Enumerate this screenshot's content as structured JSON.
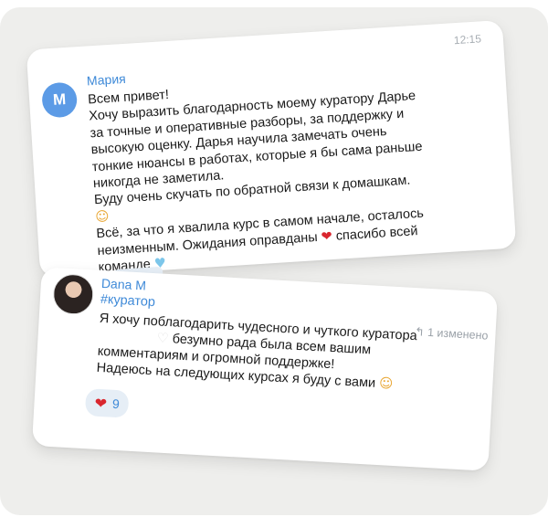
{
  "card1": {
    "time": "12:15",
    "avatar_letter": "М",
    "author": "Мария",
    "lines": [
      "Всем привет!",
      "Хочу выразить благодарность моему куратору Дарье",
      "за точные и оперативные разборы, за поддержку и",
      "высокую оценку. Дарья научила замечать очень",
      "тонкие нюансы в работах, которые я бы сама раньше",
      "никогда не заметила.",
      "Буду очень скучать по обратной связи к домашкам."
    ],
    "emoji_blush": "☺",
    "line_tail_1": "Всё, за что я хвалила курс в самом начале, осталось",
    "line_tail_2a": "неизменным. Ожидания оправданы",
    "emoji_red_heart": "❤",
    "line_tail_2b": "спасибо всей",
    "line_tail_3": "команде",
    "emoji_blue_heart": "♥"
  },
  "card2": {
    "author": "Dana M",
    "tag": "#куратор",
    "reply_icon": "↰",
    "edited_label": "1 изменено",
    "line1": "Я хочу поблагодарить чудесного и чуткого куратора",
    "emoji_white_heart": "♡",
    "line2": "безумно рада была всем вашим",
    "line3": "комментариям и огромной поддержке!",
    "line4": "Надеюсь на следующих курсах я буду с вами",
    "emoji_smiling_hearts": "☺",
    "reaction_emoji": "❤",
    "reaction_count": "9"
  },
  "colors": {
    "accent": "#3f8ad8",
    "avatar_bg": "#5c9be6",
    "background": "#eeeeec",
    "reaction_bg": "#e6eef6",
    "red_heart": "#d9262e"
  }
}
